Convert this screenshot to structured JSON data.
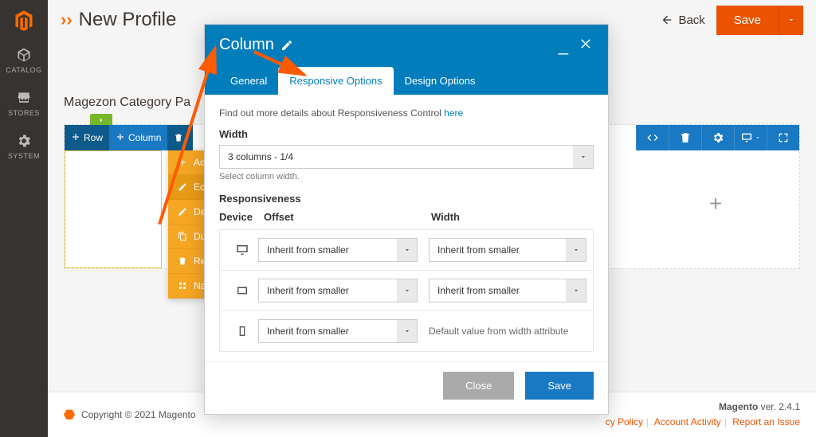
{
  "sidebar": {
    "items": [
      {
        "label": "CATALOG",
        "icon": "cube"
      },
      {
        "label": "STORES",
        "icon": "store"
      },
      {
        "label": "SYSTEM",
        "icon": "gear"
      }
    ]
  },
  "header": {
    "title": "New Profile",
    "back_label": "Back",
    "save_label": "Save"
  },
  "page": {
    "section_title": "Magezon Category Pa"
  },
  "builder": {
    "row_label": "Row",
    "column_label": "Column"
  },
  "context_menu": {
    "items": [
      {
        "label": "Add Element",
        "icon": "plus"
      },
      {
        "label": "Edit",
        "icon": "pencil",
        "active": true
      },
      {
        "label": "Design Options",
        "icon": "pencil"
      },
      {
        "label": "Duplicate",
        "icon": "copy"
      },
      {
        "label": "Remove",
        "icon": "trash"
      },
      {
        "label": "Navigator",
        "icon": "nav"
      }
    ]
  },
  "dialog": {
    "title": "Column",
    "tabs": {
      "general": "General",
      "responsive": "Responsive Options",
      "design": "Design Options"
    },
    "hint_prefix": "Find out more details about Responsiveness Control ",
    "hint_link": "here",
    "width_label": "Width",
    "width_value": "3 columns - 1/4",
    "width_note": "Select column width.",
    "responsiveness_label": "Responsiveness",
    "col_device": "Device",
    "col_offset": "Offset",
    "col_width": "Width",
    "inherit": "Inherit from smaller",
    "default_width_text": "Default value from width attribute",
    "close_label": "Close",
    "save_label": "Save"
  },
  "footer": {
    "copyright": "Copyright © 2021 Magento",
    "brand": "Magento",
    "version_label": " ver. ",
    "version": "2.4.1",
    "links": {
      "privacy": "cy Policy",
      "activity": "Account Activity",
      "report": "Report an Issue"
    }
  }
}
